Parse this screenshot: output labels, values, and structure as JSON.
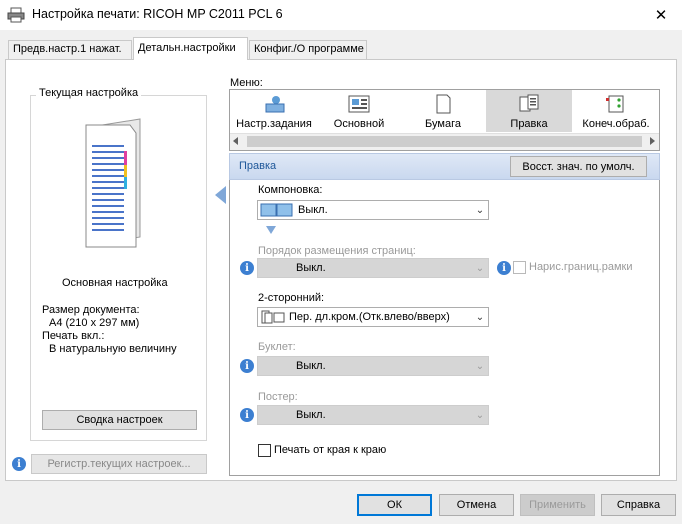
{
  "window": {
    "title": "Настройка печати: RICOH MP C2011 PCL 6",
    "close_glyph": "✕"
  },
  "tabs": [
    {
      "label": "Предв.настр.1 нажат."
    },
    {
      "label": "Детальн.настройки"
    },
    {
      "label": "Конфиг./О программе"
    }
  ],
  "left_panel": {
    "group_title": "Текущая настройка",
    "mode": "Основная настройка",
    "doc_size_label": "Размер документа:",
    "doc_size_value": "A4 (210 x 297 мм)",
    "print_on_label": "Печать вкл.:",
    "print_on_value": "В натуральную величину",
    "summary_button": "Сводка настроек",
    "register_button": "Регистр.текущих настроек..."
  },
  "menu": {
    "label": "Меню:",
    "items": [
      {
        "label": "Настр.задания",
        "icon": "job-settings-icon"
      },
      {
        "label": "Основной",
        "icon": "basic-icon"
      },
      {
        "label": "Бумага",
        "icon": "paper-icon"
      },
      {
        "label": "Правка",
        "icon": "edit-icon"
      },
      {
        "label": "Конеч.обраб.",
        "icon": "finishing-icon"
      }
    ]
  },
  "section": {
    "title": "Правка",
    "reset_button": "Восст. знач. по умолч."
  },
  "fields": {
    "layout_label": "Компоновка:",
    "layout_value": "Выкл.",
    "page_order_label": "Порядок размещения страниц:",
    "page_order_value": "Выкл.",
    "draw_frame_label": "Нарис.границ.рамки",
    "duplex_label": "2-сторонний:",
    "duplex_value": "Пер. дл.кром.(Отк.влево/вверх)",
    "booklet_label": "Буклет:",
    "booklet_value": "Выкл.",
    "poster_label": "Постер:",
    "poster_value": "Выкл.",
    "edge_to_edge_label": "Печать от края к краю",
    "info_glyph": "i"
  },
  "buttons": {
    "ok": "ОК",
    "cancel": "Отмена",
    "apply": "Применить",
    "help": "Справка"
  },
  "colors": {
    "accent": "#0078d7",
    "section_title": "#1e5799",
    "info": "#3c7fd1"
  }
}
